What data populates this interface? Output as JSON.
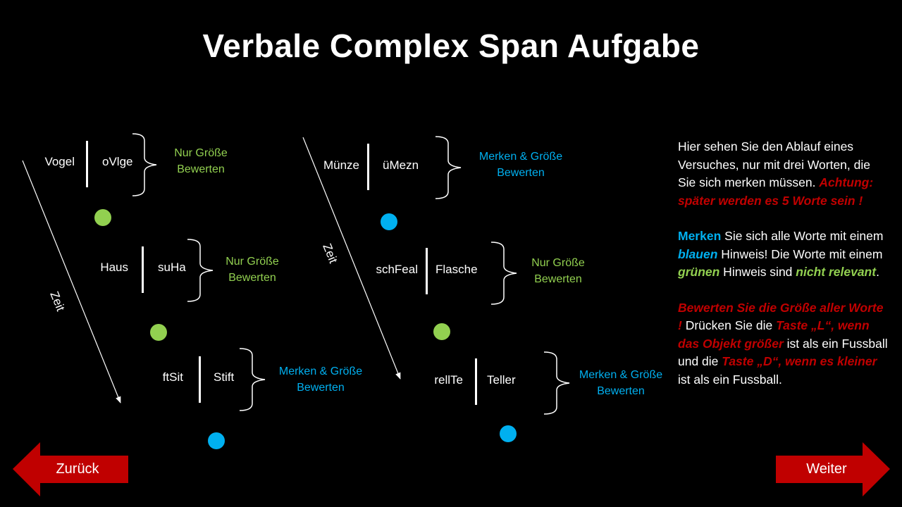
{
  "title": "Verbale Complex Span Aufgabe",
  "time_label": "Zeit",
  "sequence1": [
    {
      "word": "Vogel",
      "scrambled": "oVlge",
      "note_line1": "Nur Größe",
      "note_line2": "Bewerten",
      "note_color": "green",
      "dot": "green"
    },
    {
      "word": "Haus",
      "scrambled": "suHa",
      "note_line1": "Nur Größe",
      "note_line2": "Bewerten",
      "note_color": "green",
      "dot": "green"
    },
    {
      "word": "ftSit",
      "scrambled": "Stift",
      "note_line1": "Merken & Größe",
      "note_line2": "Bewerten",
      "note_color": "blue",
      "dot": "blue"
    }
  ],
  "sequence2": [
    {
      "word": "Münze",
      "scrambled": "üMezn",
      "note_line1": "Merken & Größe",
      "note_line2": "Bewerten",
      "note_color": "blue",
      "dot": "blue"
    },
    {
      "word": "schFeal",
      "scrambled": "Flasche",
      "note_line1": "Nur Größe",
      "note_line2": "Bewerten",
      "note_color": "green",
      "dot": "green"
    },
    {
      "word": "rellTe",
      "scrambled": "Teller",
      "note_line1": "Merken & Größe",
      "note_line2": "Bewerten",
      "note_color": "blue",
      "dot": "blue"
    }
  ],
  "instructions": {
    "p1_text": "Hier sehen Sie den Ablauf eines Versuches, nur mit drei Worten, die Sie sich merken müssen.",
    "p1_warning": "Achtung: später werden es 5 Worte sein !",
    "p2_merken": "Merken",
    "p2_t1": " Sie sich alle Worte mit einem ",
    "p2_blauen": "blauen",
    "p2_t2": " Hinweis! Die Worte mit einem ",
    "p2_gruenen": "grünen",
    "p2_t3": " Hinweis sind ",
    "p2_nicht": "nicht relevant",
    "p2_t4": ".",
    "p3_r1": "Bewerten Sie die Größe aller Worte !",
    "p3_t1": " Drücken Sie die ",
    "p3_r2": "Taste „L“, wenn das Objekt größer",
    "p3_t2": " ist als ein Fussball und die ",
    "p3_r3": "Taste „D“, wenn es kleiner",
    "p3_t3": " ist als ein Fussball."
  },
  "nav": {
    "back_label": "Zurück",
    "next_label": "Weiter"
  },
  "colors": {
    "green": "#92d050",
    "blue": "#00b0f0",
    "red": "#c00000",
    "background": "#000000"
  }
}
